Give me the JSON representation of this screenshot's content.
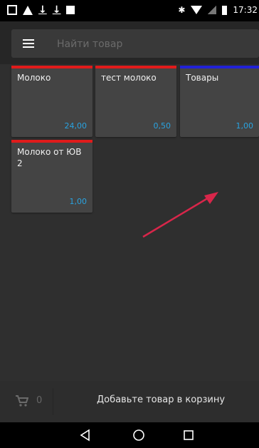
{
  "status_bar": {
    "time": "17:32",
    "icons": [
      "gallery-icon",
      "warning-icon",
      "download-icon",
      "download-icon",
      "square-icon",
      "bluetooth-icon",
      "wifi-icon",
      "signal-icon",
      "battery-icon"
    ]
  },
  "search": {
    "placeholder": "Найти товар",
    "value": ""
  },
  "products": [
    {
      "name": "Молоко",
      "price": "24,00",
      "color": "#e01b1b"
    },
    {
      "name": "тест молоко",
      "price": "0,50",
      "color": "#e01b1b"
    },
    {
      "name": "Товары",
      "price": "1,00",
      "color": "#2222d6"
    },
    {
      "name": "Молоко от ЮВ 2",
      "price": "1,00",
      "color": "#e01b1b"
    }
  ],
  "cart": {
    "count": "0",
    "hint": "Добавьте товар в корзину"
  },
  "colors": {
    "background": "#2f2f2f",
    "tile": "#444444",
    "price": "#29a3e0",
    "annotation_arrow": "#d8264a"
  }
}
